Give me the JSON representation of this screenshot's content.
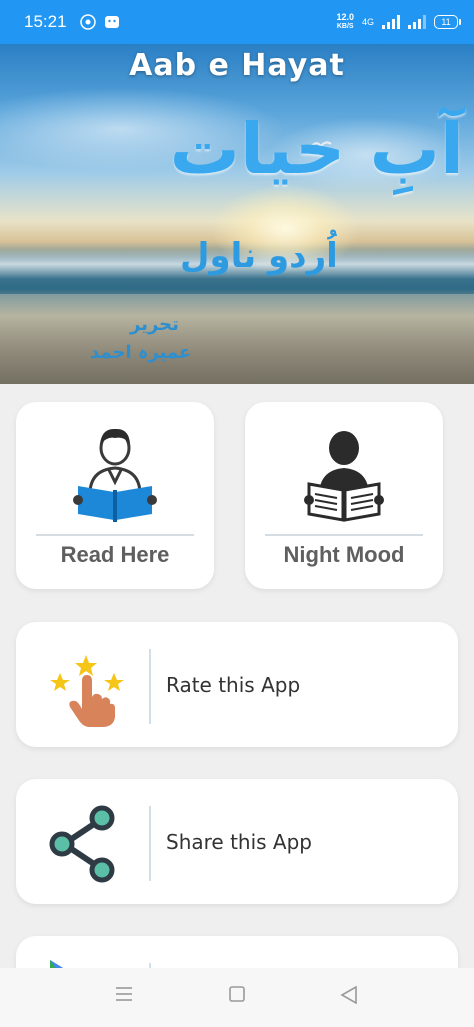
{
  "status_bar": {
    "time": "15:21",
    "speed_value": "12.0",
    "speed_unit": "KB/S",
    "network": "4G",
    "battery": "11"
  },
  "banner": {
    "title": "Aab e Hayat",
    "urdu_title": "آبِ حیات",
    "urdu_subtitle": "اُردو ناول",
    "urdu_author_label": "تحریر",
    "urdu_author_name": "عمیرہ احمد"
  },
  "tiles": [
    {
      "label": "Read Here",
      "icon": "reader-icon"
    },
    {
      "label": "Night Mood",
      "icon": "night-reader-icon"
    }
  ],
  "rows": [
    {
      "label": "Rate this App",
      "icon": "rate-stars-icon"
    },
    {
      "label": "Share this App",
      "icon": "share-icon"
    }
  ],
  "colors": {
    "status_bar": "#2196f3",
    "accent_blue": "#1e88d8",
    "label_gray": "#5f5f5f"
  }
}
